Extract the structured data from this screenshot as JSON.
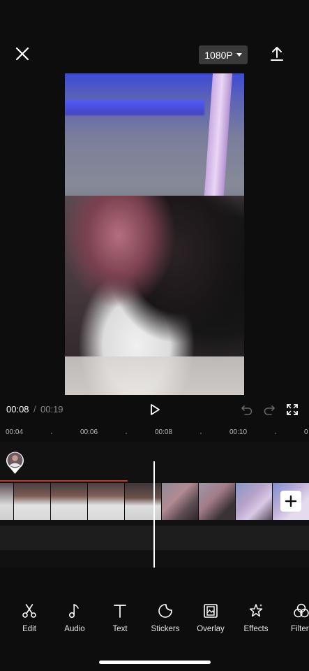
{
  "header": {
    "resolution_label": "1080P"
  },
  "playback": {
    "current_time": "00:08",
    "separator": "/",
    "total_time": "00:19"
  },
  "ruler": {
    "labels": [
      "00:04",
      "00:06",
      "00:08",
      "00:10",
      "0"
    ]
  },
  "toolbar": {
    "items": [
      {
        "label": "Edit",
        "icon": "scissors-icon"
      },
      {
        "label": "Audio",
        "icon": "music-note-icon"
      },
      {
        "label": "Text",
        "icon": "text-icon"
      },
      {
        "label": "Stickers",
        "icon": "sticker-icon"
      },
      {
        "label": "Overlay",
        "icon": "overlay-icon"
      },
      {
        "label": "Effects",
        "icon": "effects-star-icon"
      },
      {
        "label": "Filter",
        "icon": "filter-icon"
      }
    ]
  },
  "colors": {
    "background": "#0d0d0d",
    "playhead": "#ffffff",
    "clip_marker": "#c0392b"
  }
}
